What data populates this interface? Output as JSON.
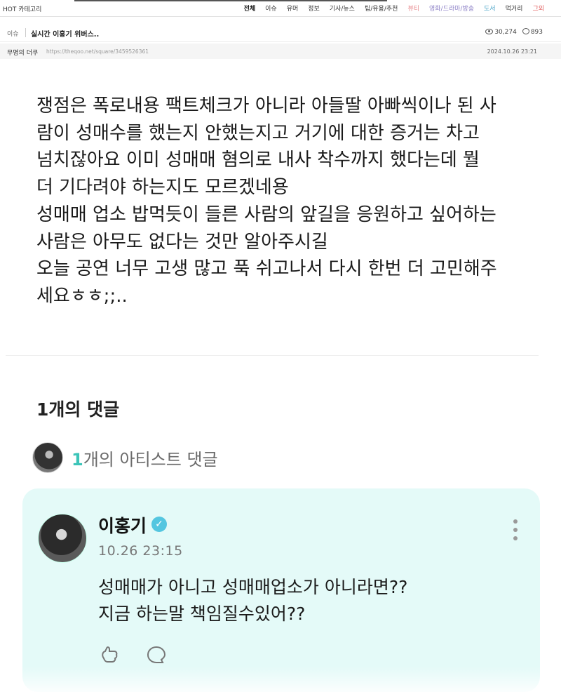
{
  "topbar": {
    "hot_label": "HOT",
    "category_label": "카테고리",
    "nav": [
      {
        "label": "전체",
        "color": "#111111",
        "active": true
      },
      {
        "label": "이슈",
        "color": "#333333"
      },
      {
        "label": "유머",
        "color": "#333333"
      },
      {
        "label": "정보",
        "color": "#333333"
      },
      {
        "label": "기사/뉴스",
        "color": "#333333"
      },
      {
        "label": "팁/유용/추천",
        "color": "#333333"
      },
      {
        "label": "뷰티",
        "color": "#e8898e"
      },
      {
        "label": "영화/드라마/방송",
        "color": "#8b7fc6"
      },
      {
        "label": "도서",
        "color": "#4ba5c8"
      },
      {
        "label": "먹거리",
        "color": "#333333"
      },
      {
        "label": "그외",
        "color": "#e05b5b"
      }
    ]
  },
  "post": {
    "category": "이슈",
    "title": "실시간 이홍기 위버스..",
    "views": "30,274",
    "comments": "893",
    "author": "무명의 더쿠",
    "url": "https://theqoo.net/square/3459526361",
    "date": "2024.10.26 23:21",
    "body_lines": [
      "쟁점은 폭로내용 팩트체크가 아니라 아들딸 아빠씩이나 된 사",
      "람이 성매수를 했는지 안했는지고 거기에 대한 증거는 차고",
      "넘치잖아요 이미 성매매 혐의로 내사 착수까지 했다는데 뭘",
      "더 기다려야 하는지도 모르겠네용",
      "성매매 업소 밥먹듯이 들른 사람의 앞길을 응원하고 싶어하는",
      "사람은 아무도 없다는 것만 알아주시길",
      "오늘 공연 너무 고생 많고 푹 쉬고나서 다시 한번 더 고민해주",
      "세요ㅎㅎ;;.."
    ]
  },
  "comments": {
    "heading": "1개의 댓글",
    "artist_count": "1",
    "artist_label": "개의 아티스트 댓글",
    "accent_color": "#3bc4b8",
    "card_bg": "#e4faf8",
    "items": [
      {
        "name": "이홍기",
        "time": "10.26 23:15",
        "lines": [
          "성매매가 아니고 성매매업소가 아니라면??",
          "지금 하는말 책임질수있어??"
        ]
      }
    ]
  }
}
